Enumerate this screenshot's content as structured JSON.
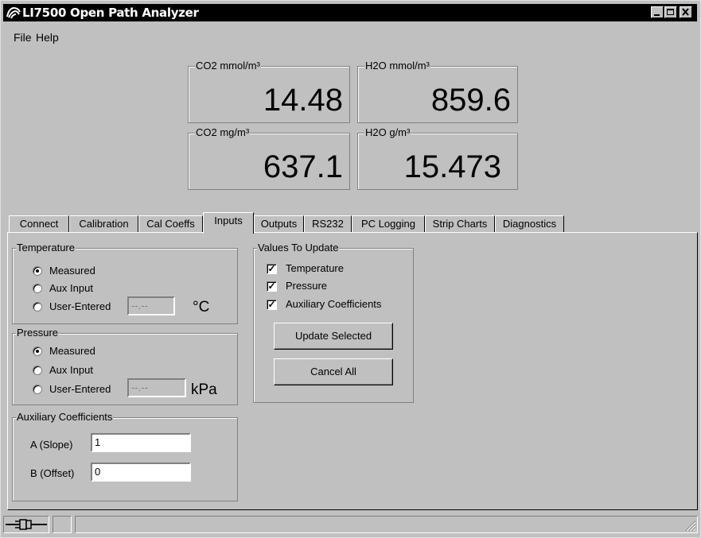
{
  "window": {
    "title": "LI7500 Open Path Analyzer"
  },
  "menu": {
    "file": "File",
    "help": "Help"
  },
  "readouts": [
    {
      "label": "CO2 mmol/m³",
      "value": "14.48"
    },
    {
      "label": "H2O mmol/m³",
      "value": "859.6"
    },
    {
      "label": "CO2 mg/m³",
      "value": "637.1"
    },
    {
      "label": "H2O g/m³",
      "value": "15.473"
    }
  ],
  "tabs": [
    "Connect",
    "Calibration",
    "Cal Coeffs",
    "Inputs",
    "Outputs",
    "RS232",
    "PC Logging",
    "Strip Charts",
    "Diagnostics"
  ],
  "active_tab": "Inputs",
  "temperature": {
    "title": "Temperature",
    "options": [
      "Measured",
      "Aux Input",
      "User-Entered"
    ],
    "selected": "Measured",
    "user_value": "--.--",
    "unit": "°C"
  },
  "pressure": {
    "title": "Pressure",
    "options": [
      "Measured",
      "Aux Input",
      "User-Entered"
    ],
    "selected": "Measured",
    "user_value": "--.--",
    "unit": "kPa"
  },
  "aux": {
    "title": "Auxiliary Coefficients",
    "a_label": "A (Slope)",
    "a_value": "1",
    "b_label": "B (Offset)",
    "b_value": "0"
  },
  "update": {
    "title": "Values To Update",
    "checks": [
      "Temperature",
      "Pressure",
      "Auxiliary Coefficients"
    ],
    "update_btn": "Update Selected",
    "cancel_btn": "Cancel All"
  },
  "icons": [
    "app-icon",
    "minimize-icon",
    "maximize-icon",
    "close-icon",
    "connection-plug-icon",
    "resize-grip-icon"
  ]
}
